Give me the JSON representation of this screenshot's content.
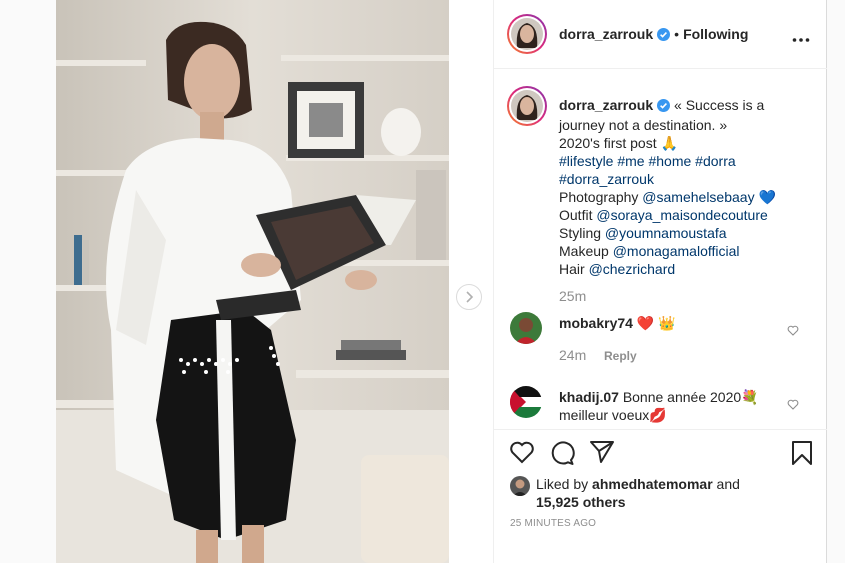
{
  "header": {
    "username": "dorra_zarrouk",
    "separator": "•",
    "follow_status": "Following"
  },
  "caption": {
    "username": "dorra_zarrouk",
    "line1": "« Success is a journey not a destination. »",
    "line2": "2020's first post 🙏",
    "hashtags": "#lifestyle #me #home #dorra #dorra_zarrouk",
    "photography_label": "Photography",
    "photography_handle": "@samehelsebaay",
    "photography_emoji": "💙",
    "outfit_label": "Outfit",
    "outfit_handle": "@soraya_maisondecouture",
    "styling_label": "Styling",
    "styling_handle": "@youmnamoustafa",
    "makeup_label": "Makeup",
    "makeup_handle": "@monagamalofficial",
    "hair_label": "Hair",
    "hair_handle": "@chezrichard",
    "time": "25m"
  },
  "comments": [
    {
      "username": "mobakry74",
      "text": "❤️ 👑",
      "time": "24m",
      "reply": "Reply"
    },
    {
      "username": "khadij.07",
      "text": "Bonne année 2020💐 meilleur voeux💋"
    }
  ],
  "likes": {
    "prefix": "Liked by",
    "user": "ahmedhatemomar",
    "and": "and",
    "others": "15,925 others"
  },
  "post_age": "25 MINUTES AGO",
  "icons": [
    "chevron-right-icon",
    "verified-badge-icon",
    "more-options-icon",
    "heart-icon",
    "comment-icon",
    "share-icon",
    "bookmark-icon"
  ],
  "colors": {
    "link": "#00376b",
    "verified": "#3897f0",
    "muted": "#8e8e8e",
    "border": "#dbdbdb"
  }
}
